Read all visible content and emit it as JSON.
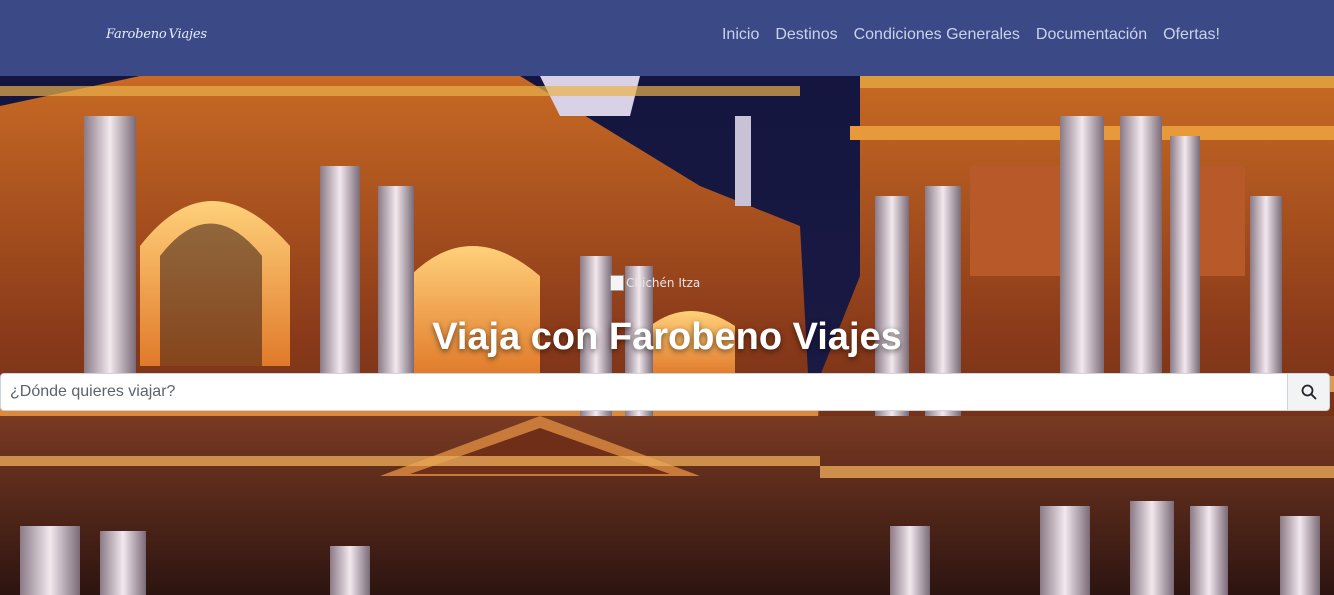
{
  "brand": {
    "name_part1": "Farobeno",
    "name_part2": "Viajes"
  },
  "nav": {
    "items": [
      {
        "label": "Inicio"
      },
      {
        "label": "Destinos"
      },
      {
        "label": "Condiciones Generales"
      },
      {
        "label": "Documentación"
      },
      {
        "label": "Ofertas!"
      }
    ]
  },
  "hero": {
    "image_alt": "Chichén Itza",
    "title": "Viaja con Farobeno Viajes",
    "background_description_icon": "cathedral-photo"
  },
  "search": {
    "placeholder": "¿Dónde quieres viajar?",
    "value": "",
    "button_icon": "search-icon"
  },
  "colors": {
    "navbar_bg": "#3b4a87",
    "nav_text": "#c9d2ea",
    "hero_title": "#ffffff"
  }
}
